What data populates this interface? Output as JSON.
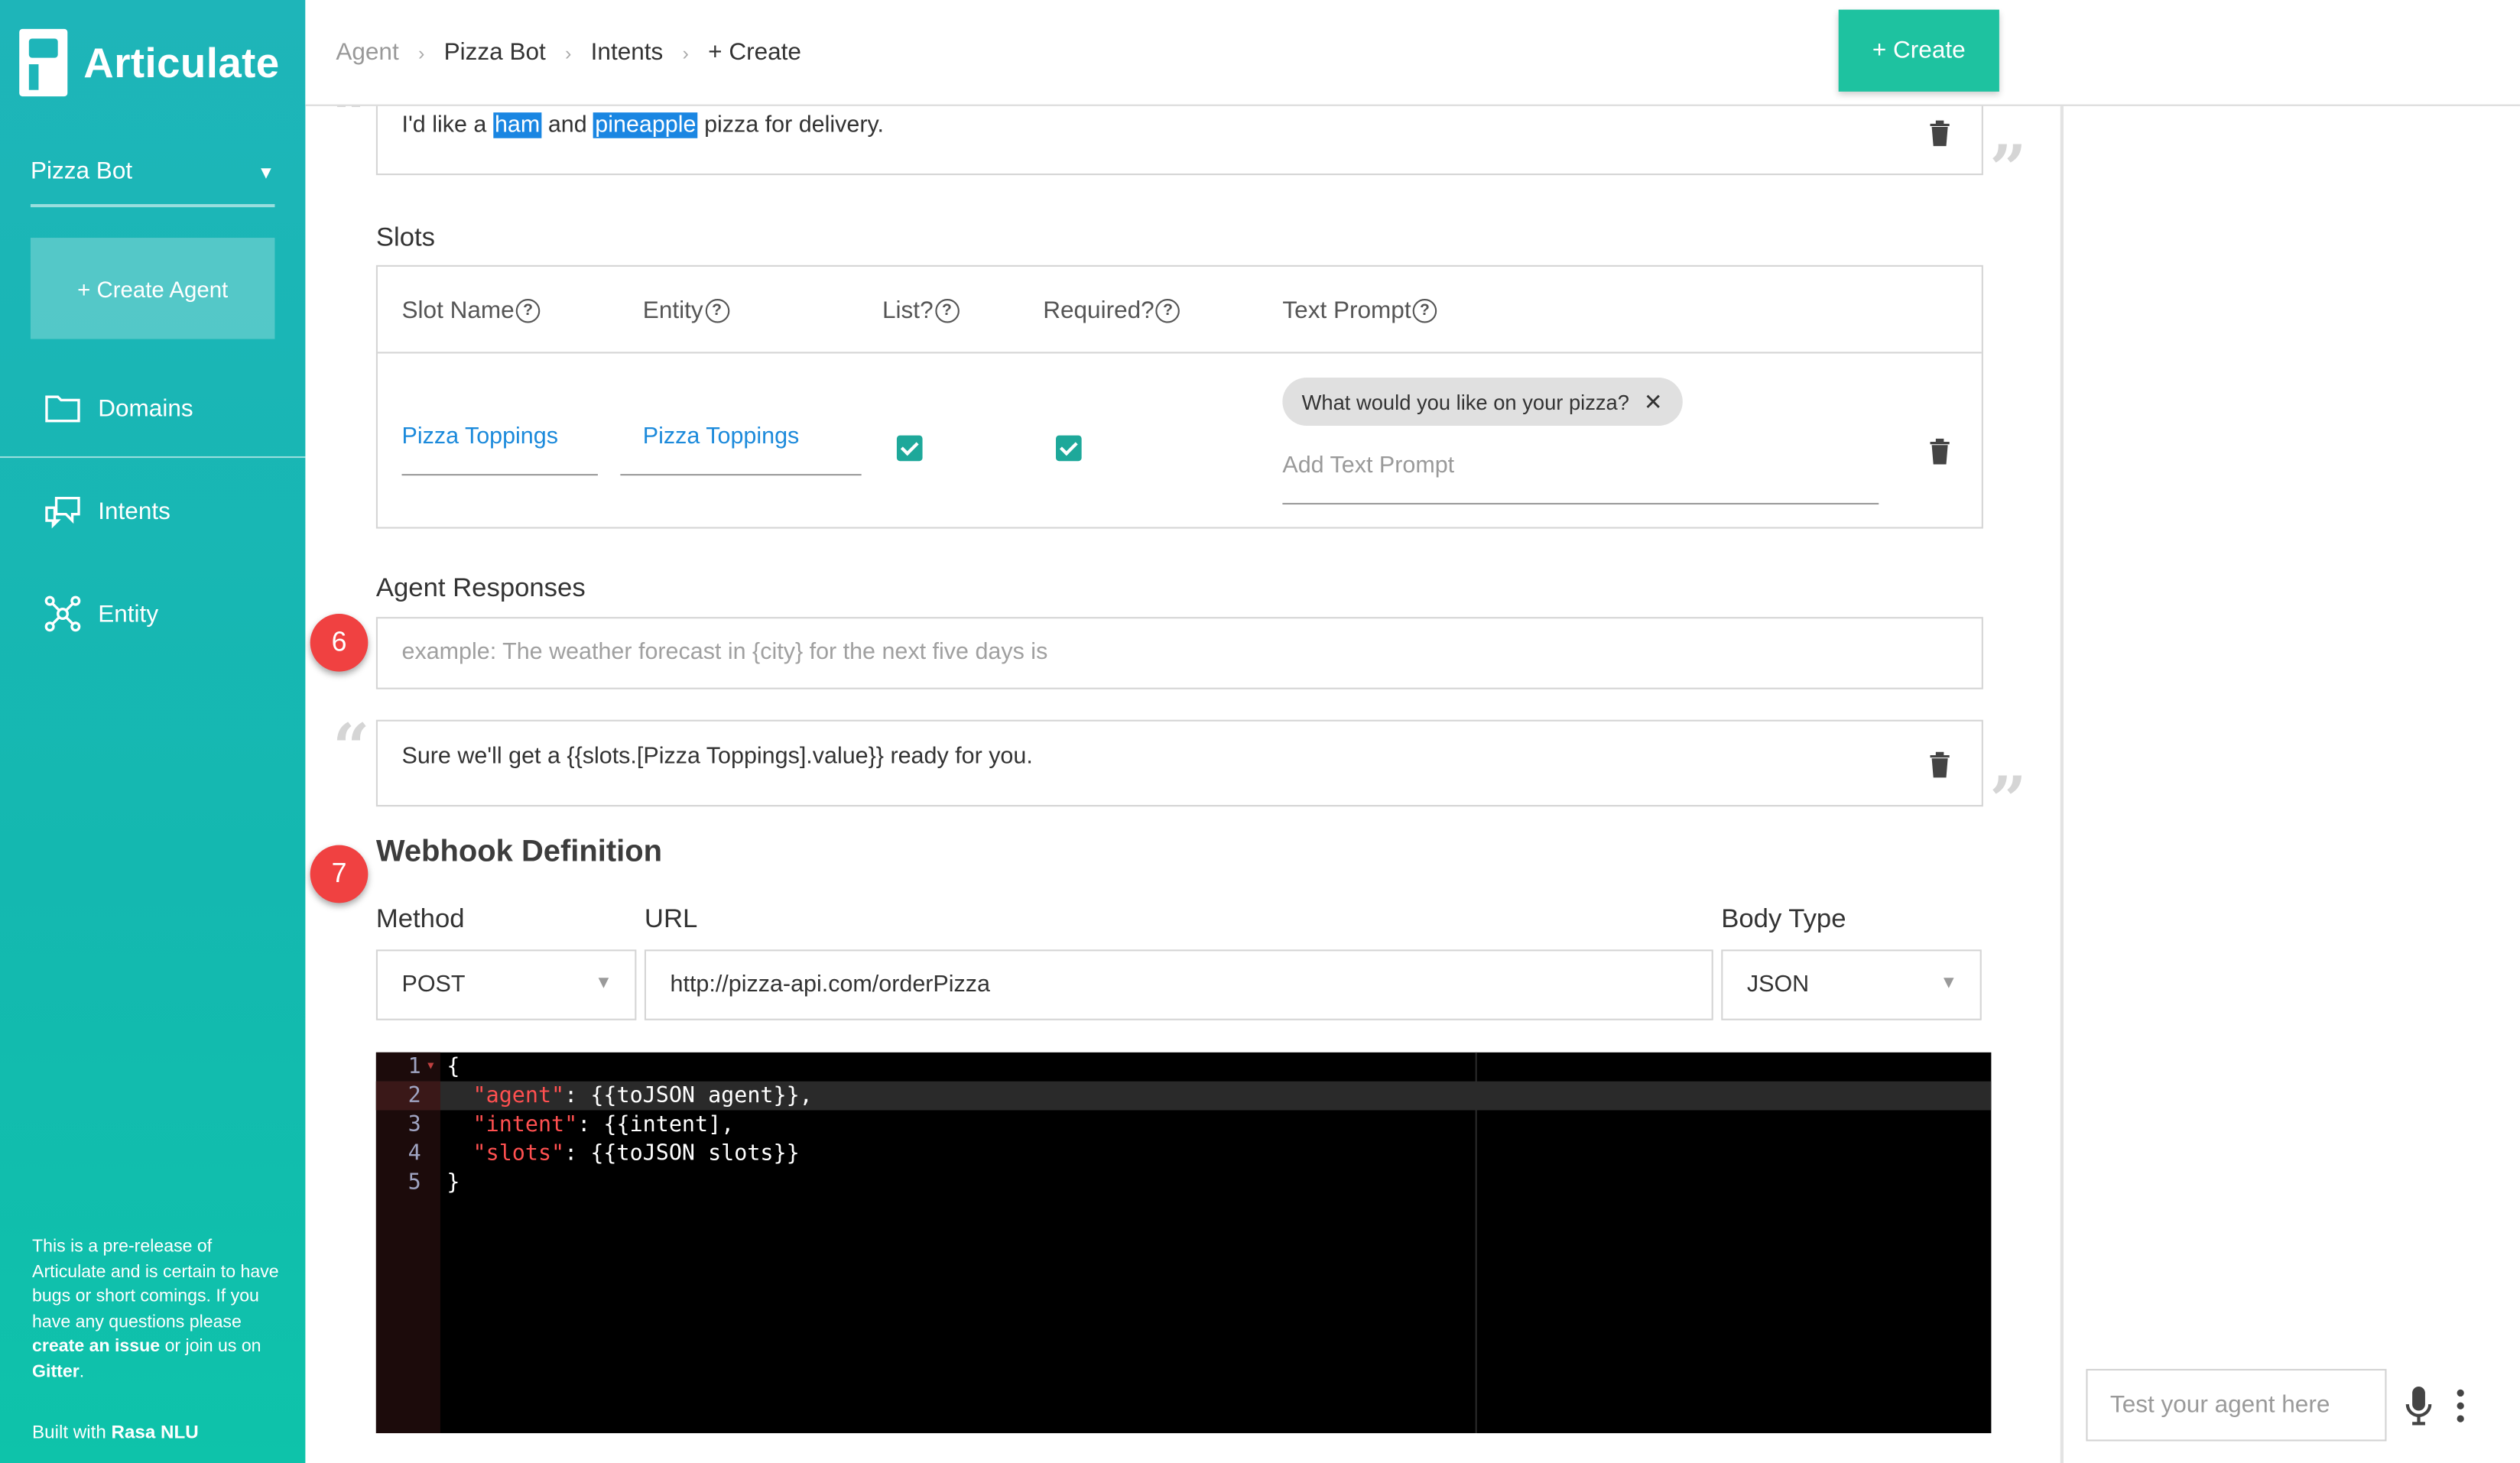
{
  "app": {
    "logo_text": "Articulate"
  },
  "sidebar": {
    "agent_name": "Pizza Bot",
    "create_agent_label": "+ Create Agent",
    "nav": [
      {
        "label": "Domains",
        "icon": "folder-icon"
      },
      {
        "label": "Intents",
        "icon": "chat-bubbles-icon"
      },
      {
        "label": "Entity",
        "icon": "network-nodes-icon"
      }
    ],
    "note_parts": [
      "This is a pre-release of Articulate and is certain to have bugs or short comings. If you have any questions please ",
      "create an issue",
      " or join us on ",
      "Gitter",
      "."
    ],
    "built_with_prefix": "Built with ",
    "built_with_name": "Rasa NLU"
  },
  "topbar": {
    "breadcrumbs": [
      "Agent",
      "Pizza Bot",
      "Intents",
      "+ Create"
    ],
    "create_label": "+ Create"
  },
  "example": {
    "parts": [
      "I'd like a ",
      "ham",
      " and ",
      "pineapple",
      " pizza for delivery."
    ]
  },
  "slots": {
    "label": "Slots",
    "headers": [
      "Slot Name",
      "Entity",
      "List?",
      "Required?",
      "Text Prompt"
    ],
    "row": {
      "slot_name": "Pizza Toppings",
      "entity": "Pizza Toppings",
      "is_list": true,
      "required": true,
      "prompts": [
        "What would you like on your pizza?"
      ],
      "add_prompt_placeholder": "Add Text Prompt"
    }
  },
  "agent_responses": {
    "label": "Agent Responses",
    "step": "6",
    "placeholder": "example: The weather forecast in {city} for the next five days is",
    "items": [
      "Sure we'll get a {{slots.[Pizza Toppings].value}} ready for you."
    ]
  },
  "webhook": {
    "title": "Webhook Definition",
    "step": "7",
    "method_label": "Method",
    "method_value": "POST",
    "url_label": "URL",
    "url_value": "http://pizza-api.com/orderPizza",
    "body_type_label": "Body Type",
    "body_type_value": "JSON",
    "code_lines": [
      {
        "n": "1",
        "text": "{"
      },
      {
        "n": "2",
        "key": "\"agent\"",
        "rest": ": {{toJSON agent}},"
      },
      {
        "n": "3",
        "key": "\"intent\"",
        "rest": ": {{intent],"
      },
      {
        "n": "4",
        "key": "\"slots\"",
        "rest": ": {{toJSON slots}}"
      },
      {
        "n": "5",
        "text": "}"
      }
    ]
  },
  "chat": {
    "placeholder": "Test your agent here"
  },
  "colors": {
    "accent": "#1ec2a0",
    "sidebar": "#1eb5b9",
    "highlight": "#1a86e2",
    "badge": "#f04141",
    "link": "#1c8adb"
  }
}
